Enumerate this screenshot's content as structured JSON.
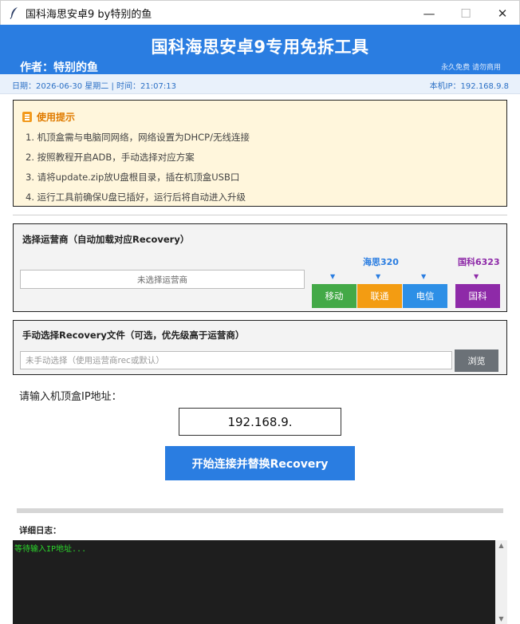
{
  "window": {
    "title": "国科海思安卓9  by特别的鱼",
    "icon": "feather-icon",
    "controls": {
      "minimize": "—",
      "maximize": "☐",
      "close": "✕"
    }
  },
  "header": {
    "title": "国科海思安卓9专用免拆工具",
    "author": "作者：特别的鱼",
    "note": "永久免费 请勿商用"
  },
  "infobar": {
    "datetime": "日期：2026-06-30  星期二  |  时间：21:07:13",
    "local_ip": "本机IP：192.168.9.8"
  },
  "tips": {
    "heading": "使用提示",
    "items": [
      "1. 机顶盒需与电脑同网络，网络设置为DHCP/无线连接",
      "2. 按照教程开启ADB，手动选择对应方案",
      "3. 请将update.zip放U盘根目录，插在机顶盒USB口",
      "4. 运行工具前确保U盘已插好，运行后将自动进入升级"
    ]
  },
  "carrier": {
    "title": "选择运营商（自动加载对应Recovery）",
    "selected": "未选择运营商",
    "group_hisi": "海思320",
    "group_guoke": "国科6323",
    "arrow": "▼",
    "buttons": {
      "mobile": "移动",
      "unicom": "联通",
      "telecom": "电信",
      "guoke": "国科"
    }
  },
  "manual": {
    "title": "手动选择Recovery文件（可选，优先级高于运营商）",
    "placeholder": "未手动选择（使用运营商rec或默认）",
    "browse": "浏览"
  },
  "ip": {
    "label": "请输入机顶盒IP地址：",
    "value": "192.168.9."
  },
  "start_button": "开始连接并替换Recovery",
  "progress": 0,
  "log": {
    "label": "详细日志：",
    "lines": [
      "等待输入IP地址..."
    ]
  },
  "colors": {
    "accent": "#2a7de1",
    "mobile": "#43a947",
    "unicom": "#f39c12",
    "telecom": "#2d8fe6",
    "guoke": "#8e2aa8",
    "tips_bg": "#fff6dc",
    "log_text": "#2bd62b"
  }
}
